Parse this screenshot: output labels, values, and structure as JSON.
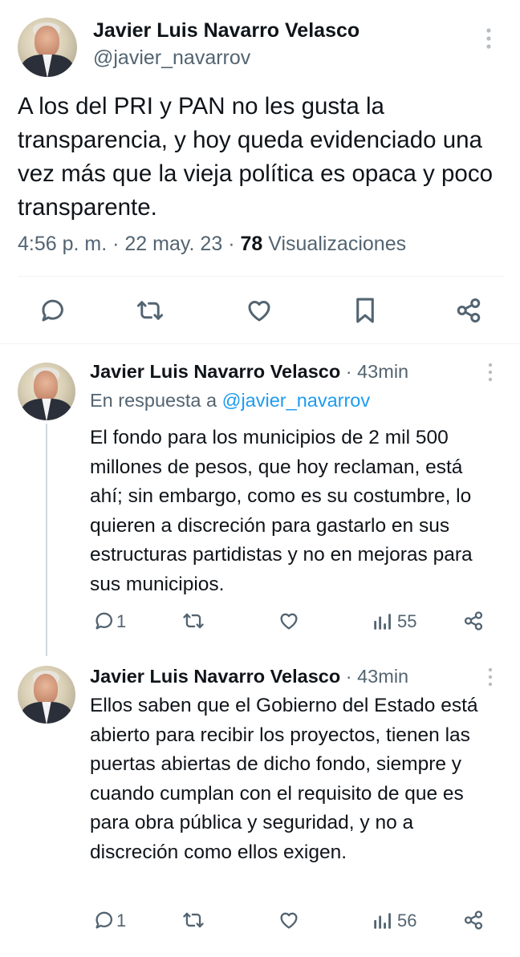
{
  "main_tweet": {
    "author_name": "Javier Luis Navarro Velasco",
    "handle": "@javier_navarrov",
    "text": "A los del PRI y PAN no les gusta la transparencia, y hoy queda evidenciado una vez más que la vieja política es opaca y poco transparente.",
    "time": "4:56 p. m.",
    "date": "22 may. 23",
    "views_count": "78",
    "views_label": "Visualizaciones",
    "sep": "·",
    "actions": [
      "reply-icon",
      "retweet-icon",
      "like-icon",
      "bookmark-icon",
      "share-icon"
    ]
  },
  "replies": [
    {
      "author_name": "Javier Luis Navarro Velasco",
      "dot": "·",
      "time_ago": "43min",
      "reply_prefix": "En respuesta a",
      "reply_handle": "@javier_navarrov",
      "text": "El fondo para los municipios de 2 mil 500 millones de pesos, que hoy reclaman, está ahí; sin embargo, como es su costumbre, lo quieren a discreción para gastarlo en sus estructuras partidistas y no en mejoras para sus municipios.",
      "reply_count": "1",
      "views": "55"
    },
    {
      "author_name": "Javier Luis Navarro Velasco",
      "dot": "·",
      "time_ago": "43min",
      "text": "Ellos saben que el Gobierno del Estado está abierto para recibir los proyectos, tienen las puertas abiertas de dicho fondo, siempre y cuando cumplan con el requisito de que es para obra pública y seguridad, y no a discreción como ellos exigen.",
      "reply_count": "1",
      "views": "56"
    }
  ],
  "colors": {
    "text": "#0f1419",
    "muted": "#536471",
    "link": "#1d9bf0",
    "divider": "#eff3f4"
  }
}
